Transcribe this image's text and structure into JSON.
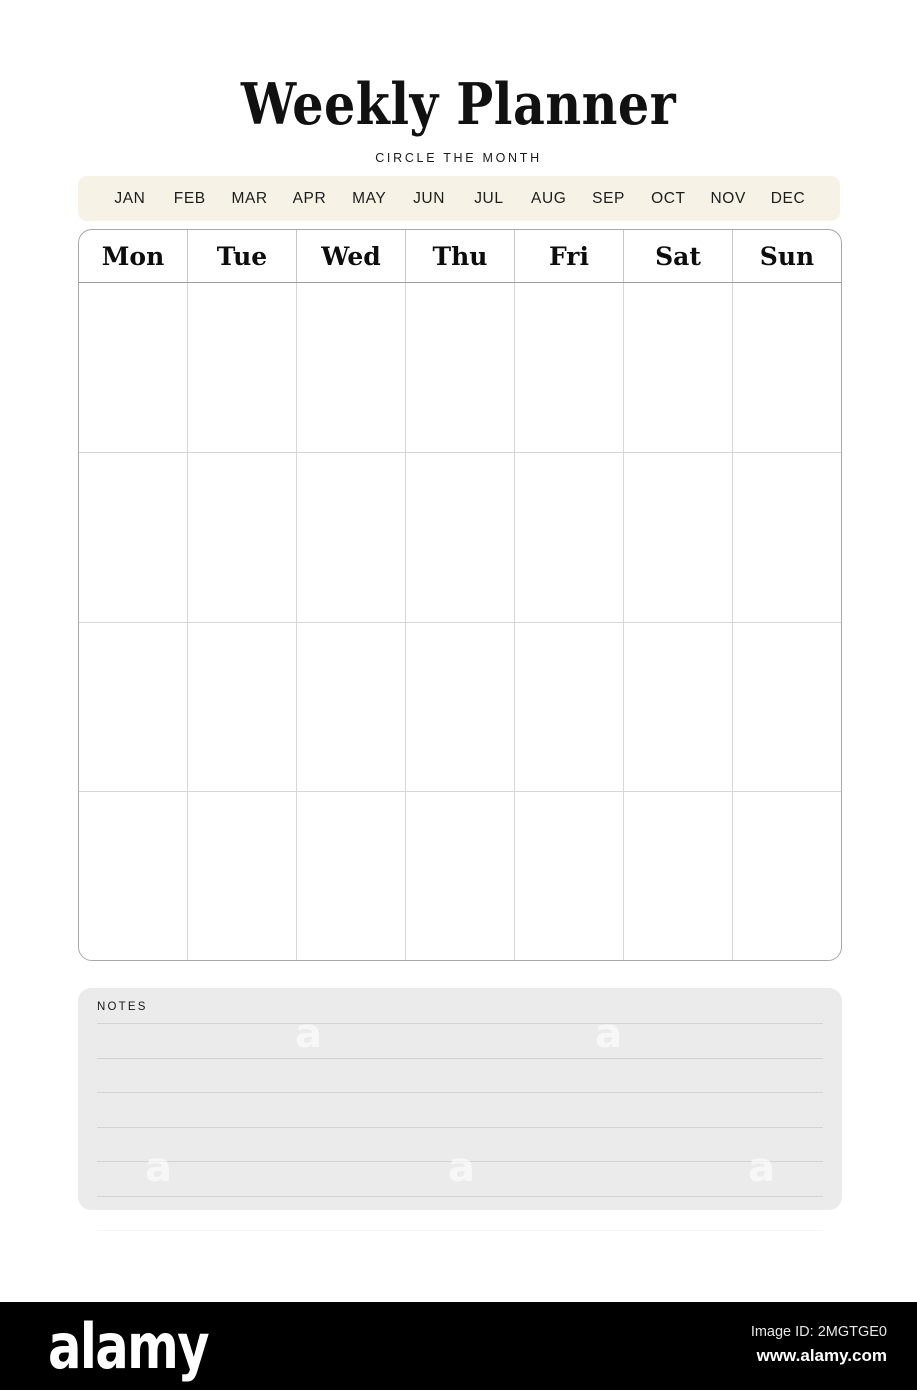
{
  "header": {
    "title": "Weekly Planner",
    "subtitle": "CIRCLE THE MONTH"
  },
  "months": {
    "items": [
      {
        "label": "JAN"
      },
      {
        "label": "FEB"
      },
      {
        "label": "MAR"
      },
      {
        "label": "APR"
      },
      {
        "label": "MAY"
      },
      {
        "label": "JUN"
      },
      {
        "label": "JUL"
      },
      {
        "label": "AUG"
      },
      {
        "label": "SEP"
      },
      {
        "label": "OCT"
      },
      {
        "label": "NOV"
      },
      {
        "label": "DEC"
      }
    ],
    "background_color": "#f7f2e6"
  },
  "calendar": {
    "day_headers": [
      "Mon",
      "Tue",
      "Wed",
      "Thu",
      "Fri",
      "Sat",
      "Sun"
    ],
    "row_count": 4,
    "column_count": 7,
    "cells": [
      [
        "",
        "",
        "",
        "",
        "",
        "",
        ""
      ],
      [
        "",
        "",
        "",
        "",
        "",
        "",
        ""
      ],
      [
        "",
        "",
        "",
        "",
        "",
        "",
        ""
      ],
      [
        "",
        "",
        "",
        "",
        "",
        "",
        ""
      ]
    ]
  },
  "notes": {
    "label": "NOTES",
    "line_count": 6,
    "lines": [
      "",
      "",
      "",
      "",
      "",
      ""
    ],
    "background_color": "#ebebeb"
  },
  "watermark": {
    "glyph": "a"
  },
  "footer": {
    "logo": "alamy",
    "image_id": "Image ID: 2MGTGE0",
    "url": "www.alamy.com",
    "background_color": "#000000"
  }
}
